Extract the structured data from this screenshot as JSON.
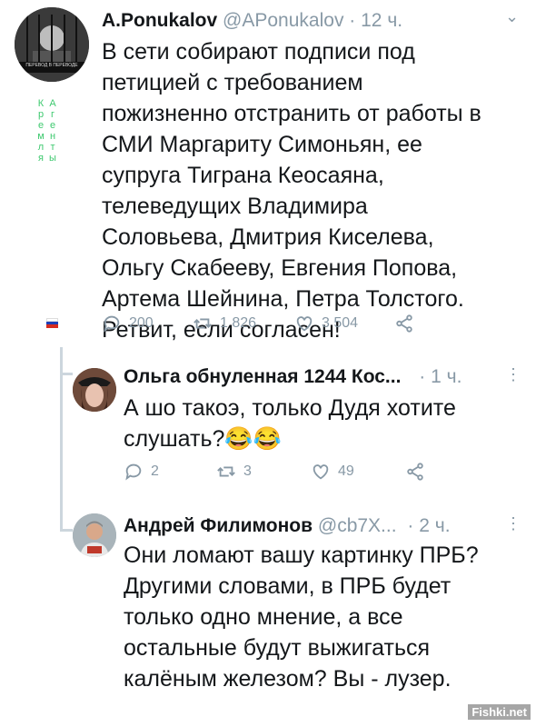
{
  "tweets": [
    {
      "author": "A.Ponukalov",
      "handle": "@APonukalov",
      "time": "· 12 ч.",
      "body": "В сети собирают подписи под петицией с требованием пожизненно отстранить от работы в СМИ Маргариту Симоньян, ее супруга Тиграна Кеосаяна, телеведущих Владимира Соловьева, Дмитрия Киселева, Ольгу Скабееву, Евгения Попова, Артема Шейнина, Петра Толстого. Ретвит, если согласен!",
      "replies": "200",
      "retweets": "1 826",
      "likes": "3 504",
      "avatar_caption": "ПЕРЕВОД В ПЕРЕВОДЕ",
      "vertical_text": "Агенты Кремля"
    },
    {
      "author": "Ольга обнуленная 1244 Кос...",
      "handle": "",
      "time": "· 1 ч.",
      "body": "А шо такоэ, только Дудя хотите слушать?😂😂",
      "replies": "2",
      "retweets": "3",
      "likes": "49"
    },
    {
      "author": "Андрей Филимонов",
      "handle": "@cb7X...",
      "time": "· 2 ч.",
      "body": "Они ломают вашу картинку ПРБ? Другими словами, в ПРБ будет только одно мнение, а все остальные будут выжигаться калёным железом? Вы - лузер."
    }
  ],
  "watermark": "Fishki.net",
  "colors": {
    "meta": "#8899a6",
    "thread_line": "#ccd6dd",
    "vertical_text": "#3ec96f"
  }
}
